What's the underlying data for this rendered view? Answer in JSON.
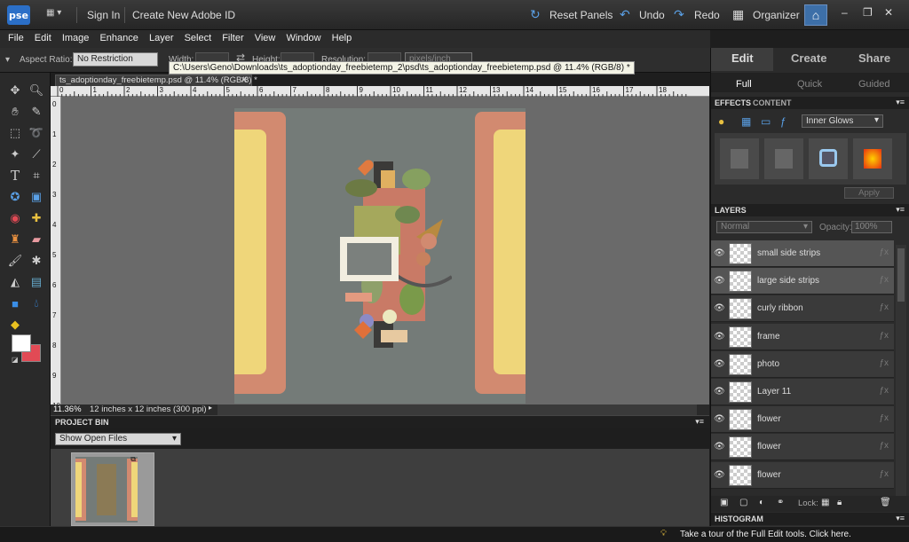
{
  "titlebar": {
    "logo": "pse",
    "sign_in": "Sign In",
    "create_id": "Create New Adobe ID",
    "reset_panels": "Reset Panels",
    "undo": "Undo",
    "redo": "Redo",
    "organizer": "Organizer",
    "window_controls": [
      "–",
      "❐",
      "✕"
    ]
  },
  "menu": [
    "File",
    "Edit",
    "Image",
    "Enhance",
    "Layer",
    "Select",
    "Filter",
    "View",
    "Window",
    "Help"
  ],
  "options": {
    "aspect_label": "Aspect Ratio:",
    "aspect_value": "No Restriction",
    "width_label": "Width:",
    "height_label": "Height:",
    "resolution_label": "Resolution:",
    "resolution_unit": "pixels/inch"
  },
  "tooltip": "C:\\Users\\Geno\\Downloads\\ts_adoptionday_freebietemp_2\\psd\\ts_adoptionday_freebietemp.psd @ 11.4% (RGB/8) *",
  "document": {
    "tab": "ts_adoptionday_freebietemp.psd @ 11.4% (RGB/8) *",
    "ruler_top": [
      "0",
      "1",
      "2",
      "3",
      "4",
      "5",
      "6",
      "7",
      "8",
      "9",
      "10",
      "11",
      "12",
      "13",
      "14",
      "15",
      "16",
      "17",
      "18"
    ],
    "ruler_left": [
      "0",
      "1",
      "2",
      "3",
      "4",
      "5",
      "6",
      "7",
      "8",
      "9",
      "10"
    ],
    "zoom": "11.36%",
    "doc_size": "12 inches x 12 inches (300 ppi)"
  },
  "project_bin": {
    "title": "PROJECT BIN",
    "select": "Show Open Files"
  },
  "right_panel": {
    "tabs": [
      "Edit",
      "Create",
      "Share"
    ],
    "subtabs": [
      "Full",
      "Quick",
      "Guided"
    ],
    "effects_tabs": [
      "EFFECTS",
      "CONTENT"
    ],
    "effects_dropdown": "Inner Glows",
    "apply": "Apply",
    "layers_title": "LAYERS",
    "blend_mode": "Normal",
    "opacity_label": "Opacity:",
    "opacity_value": "100%",
    "lock_label": "Lock:",
    "histogram": "HISTOGRAM"
  },
  "layers": [
    {
      "name": "small side strips",
      "selected": true
    },
    {
      "name": "large side strips",
      "selected": true
    },
    {
      "name": "curly ribbon",
      "selected": false
    },
    {
      "name": "frame",
      "selected": false
    },
    {
      "name": "photo",
      "selected": false
    },
    {
      "name": "Layer 11",
      "selected": false
    },
    {
      "name": "flower",
      "selected": false
    },
    {
      "name": "flower",
      "selected": false
    },
    {
      "name": "flower",
      "selected": false
    }
  ],
  "bottom_status": "Take a tour of the Full Edit tools. Click here.",
  "colors": {
    "accent": "#2b6fc7",
    "canvas_bg": "#6a6a6a",
    "paper": "#747b78",
    "strip_pink": "#d28a70",
    "strip_yellow": "#efd67a",
    "background_color_swatch": "#e24a55"
  }
}
